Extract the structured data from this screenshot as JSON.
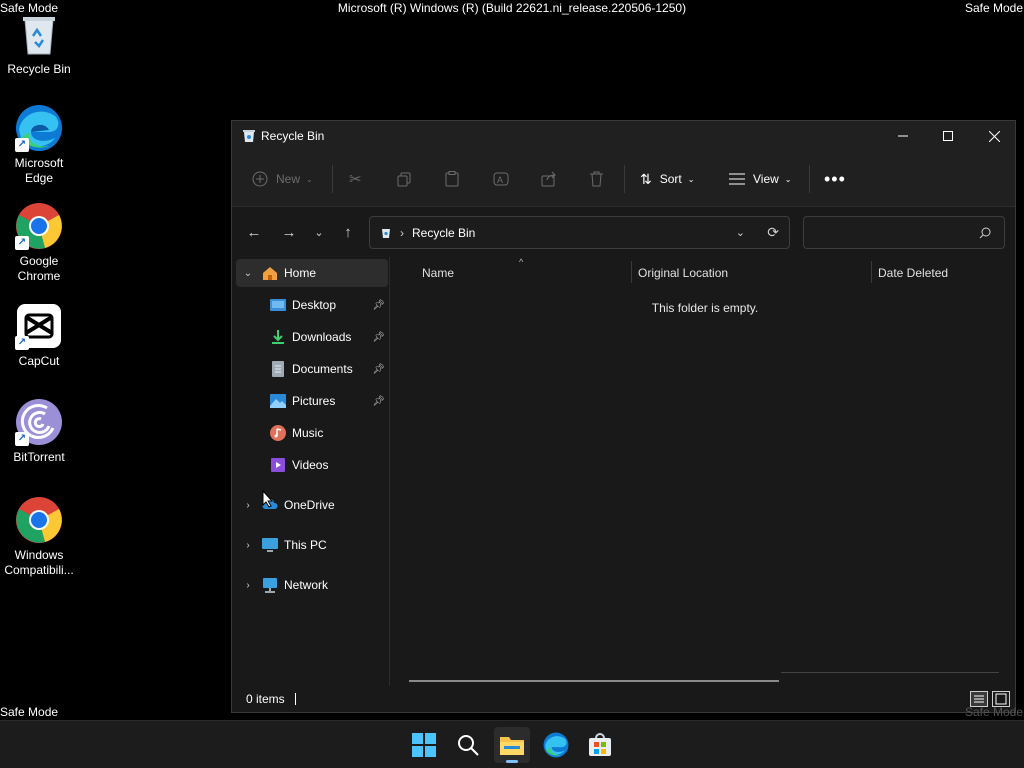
{
  "overlay": {
    "safe_mode_tl": "Safe Mode",
    "safe_mode_tr": "Safe Mode",
    "safe_mode_bl": "Safe Mode",
    "safe_mode_br": "Safe Mode",
    "build": "Microsoft (R) Windows (R) (Build 22621.ni_release.220506-1250)"
  },
  "desktop": {
    "icons": [
      {
        "label": "Recycle Bin",
        "icon": "recycle-bin-icon"
      },
      {
        "label": "Microsoft Edge",
        "icon": "edge-icon"
      },
      {
        "label": "Google Chrome",
        "icon": "chrome-icon"
      },
      {
        "label": "CapCut",
        "icon": "capcut-icon"
      },
      {
        "label": "BitTorrent",
        "icon": "bittorrent-icon"
      },
      {
        "label": "Windows Compatibili...",
        "icon": "chrome-icon"
      }
    ]
  },
  "window": {
    "title": "Recycle Bin",
    "toolbar": {
      "new_label": "New",
      "sort_label": "Sort",
      "view_label": "View"
    },
    "address": {
      "path_item": "Recycle Bin"
    },
    "nav": {
      "home": "Home",
      "quick": [
        {
          "label": "Desktop",
          "pinned": true
        },
        {
          "label": "Downloads",
          "pinned": true
        },
        {
          "label": "Documents",
          "pinned": true
        },
        {
          "label": "Pictures",
          "pinned": true
        },
        {
          "label": "Music",
          "pinned": false
        },
        {
          "label": "Videos",
          "pinned": false
        }
      ],
      "onedrive": "OneDrive",
      "this_pc": "This PC",
      "network": "Network"
    },
    "columns": [
      "Name",
      "Original Location",
      "Date Deleted"
    ],
    "empty_message": "This folder is empty.",
    "status": {
      "items": "0 items"
    }
  },
  "taskbar": {
    "items": [
      "start-icon",
      "search-icon",
      "file-explorer-icon",
      "edge-icon",
      "store-icon"
    ],
    "active": "file-explorer-icon"
  },
  "colors": {
    "accent": "#7fbfff",
    "window_bg": "#191919",
    "titlebar_bg": "#202020"
  }
}
